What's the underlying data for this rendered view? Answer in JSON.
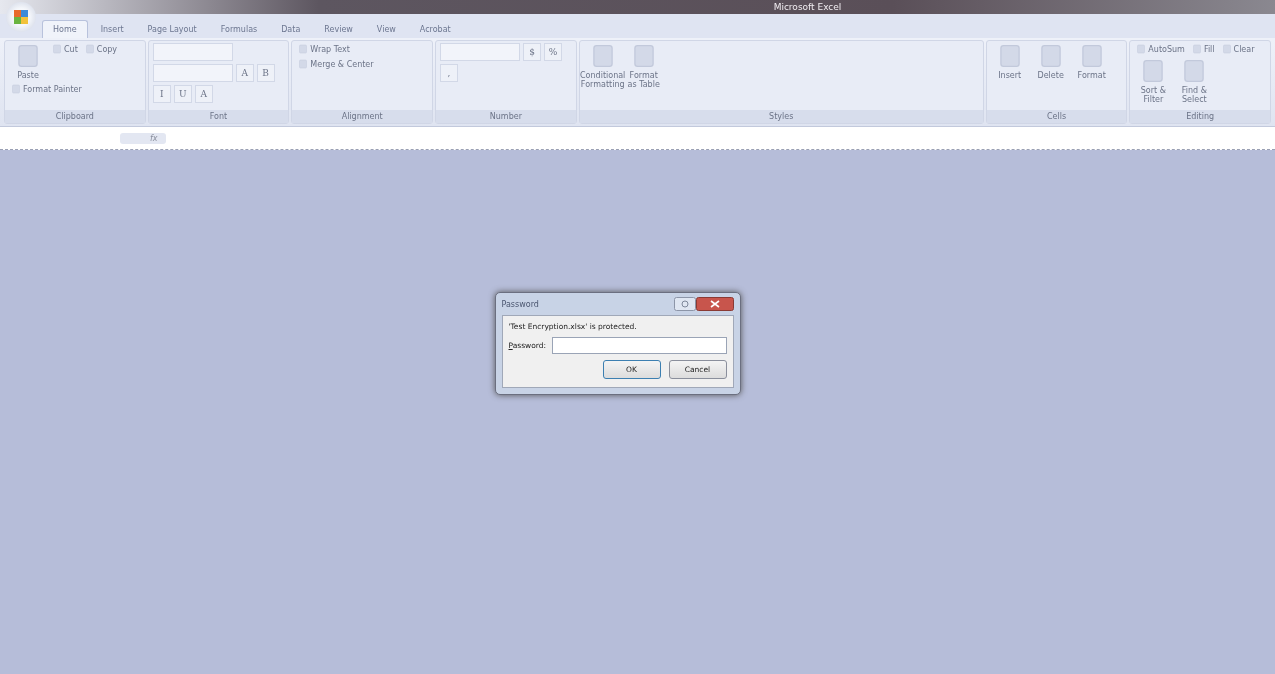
{
  "window": {
    "title": "Microsoft Excel"
  },
  "tabs": [
    {
      "label": "Home",
      "selected": true
    },
    {
      "label": "Insert",
      "selected": false
    },
    {
      "label": "Page Layout",
      "selected": false
    },
    {
      "label": "Formulas",
      "selected": false
    },
    {
      "label": "Data",
      "selected": false
    },
    {
      "label": "Review",
      "selected": false
    },
    {
      "label": "View",
      "selected": false
    },
    {
      "label": "Acrobat",
      "selected": false
    }
  ],
  "ribbon": {
    "disabled": true,
    "groups": [
      {
        "label": "Clipboard",
        "items": [
          {
            "kind": "large",
            "label": "Paste"
          },
          {
            "kind": "small",
            "label": "Cut"
          },
          {
            "kind": "small",
            "label": "Copy"
          },
          {
            "kind": "small",
            "label": "Format Painter"
          }
        ]
      },
      {
        "label": "Font",
        "items": [
          {
            "kind": "combo"
          },
          {
            "kind": "combo"
          },
          {
            "kind": "glyph",
            "label": "A"
          },
          {
            "kind": "glyph",
            "label": "B"
          },
          {
            "kind": "glyph",
            "label": "I"
          },
          {
            "kind": "glyph",
            "label": "U"
          },
          {
            "kind": "glyph",
            "label": "A"
          }
        ]
      },
      {
        "label": "Alignment",
        "items": [
          {
            "kind": "small",
            "label": "Wrap Text"
          },
          {
            "kind": "small",
            "label": "Merge & Center"
          }
        ]
      },
      {
        "label": "Number",
        "items": [
          {
            "kind": "combo"
          },
          {
            "kind": "glyph",
            "label": "$"
          },
          {
            "kind": "glyph",
            "label": "%"
          },
          {
            "kind": "glyph",
            "label": ","
          }
        ]
      },
      {
        "label": "Styles",
        "items": [
          {
            "kind": "large",
            "label": "Conditional Formatting"
          },
          {
            "kind": "large",
            "label": "Format as Table"
          }
        ]
      },
      {
        "label": "Cells",
        "items": [
          {
            "kind": "large",
            "label": "Insert"
          },
          {
            "kind": "large",
            "label": "Delete"
          },
          {
            "kind": "large",
            "label": "Format"
          }
        ]
      },
      {
        "label": "Editing",
        "items": [
          {
            "kind": "small",
            "label": "AutoSum"
          },
          {
            "kind": "small",
            "label": "Fill"
          },
          {
            "kind": "small",
            "label": "Clear"
          },
          {
            "kind": "large",
            "label": "Sort & Filter"
          },
          {
            "kind": "large",
            "label": "Find & Select"
          }
        ]
      }
    ]
  },
  "formula_bar": {
    "fx": "fx"
  },
  "dialog": {
    "title": "Password",
    "message": "'Test Encryption.xlsx' is protected.",
    "field_label": "Password:",
    "buttons": [
      "OK",
      "Cancel"
    ]
  }
}
